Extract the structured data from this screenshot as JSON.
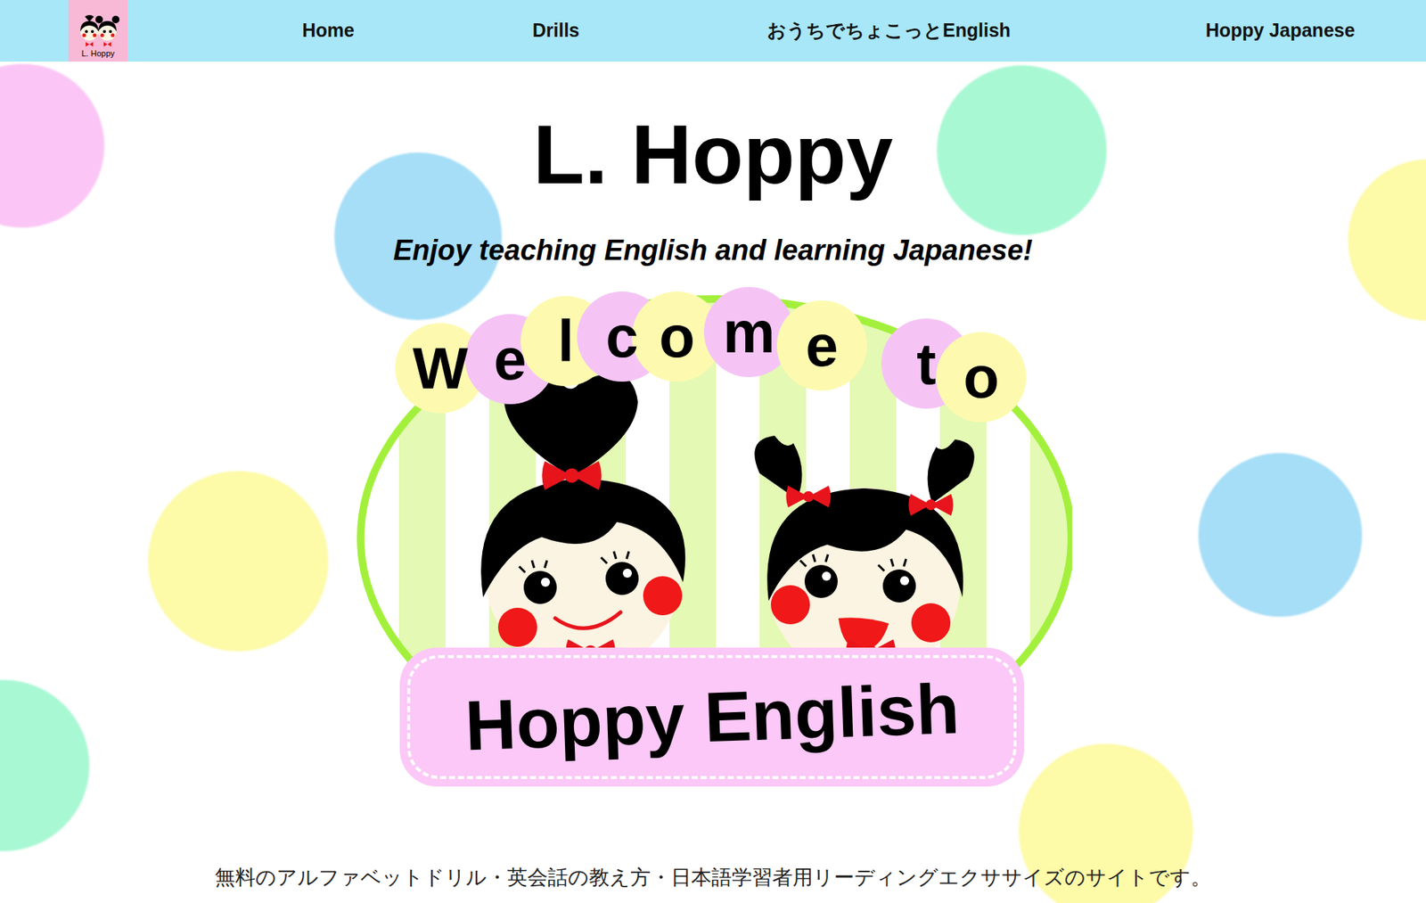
{
  "header": {
    "logo_text": "L. Hoppy",
    "nav": [
      {
        "label": "Home"
      },
      {
        "label": "Drills"
      },
      {
        "label": "おうちでちょこっとEnglish"
      },
      {
        "label": "Hoppy Japanese"
      }
    ]
  },
  "hero": {
    "title": "L. Hoppy",
    "tagline": "Enjoy teaching English and learning Japanese!"
  },
  "welcome_sign": {
    "letters": [
      {
        "char": "W",
        "color": "#fdfab0"
      },
      {
        "char": "e",
        "color": "#f5c4f5"
      },
      {
        "char": "l",
        "color": "#fdfab0"
      },
      {
        "char": "c",
        "color": "#f5c4f5"
      },
      {
        "char": "o",
        "color": "#fdfab0"
      },
      {
        "char": "m",
        "color": "#f5c4f5"
      },
      {
        "char": "e",
        "color": "#fdfab0"
      },
      {
        "char": "t",
        "color": "#f5c4f5"
      },
      {
        "char": "o",
        "color": "#fdfab0"
      }
    ],
    "banner_label": "Hoppy English"
  },
  "description": "無料のアルファベットドリル・英会話の教え方・日本語学習者用リーディングエクササイズのサイトです。"
}
